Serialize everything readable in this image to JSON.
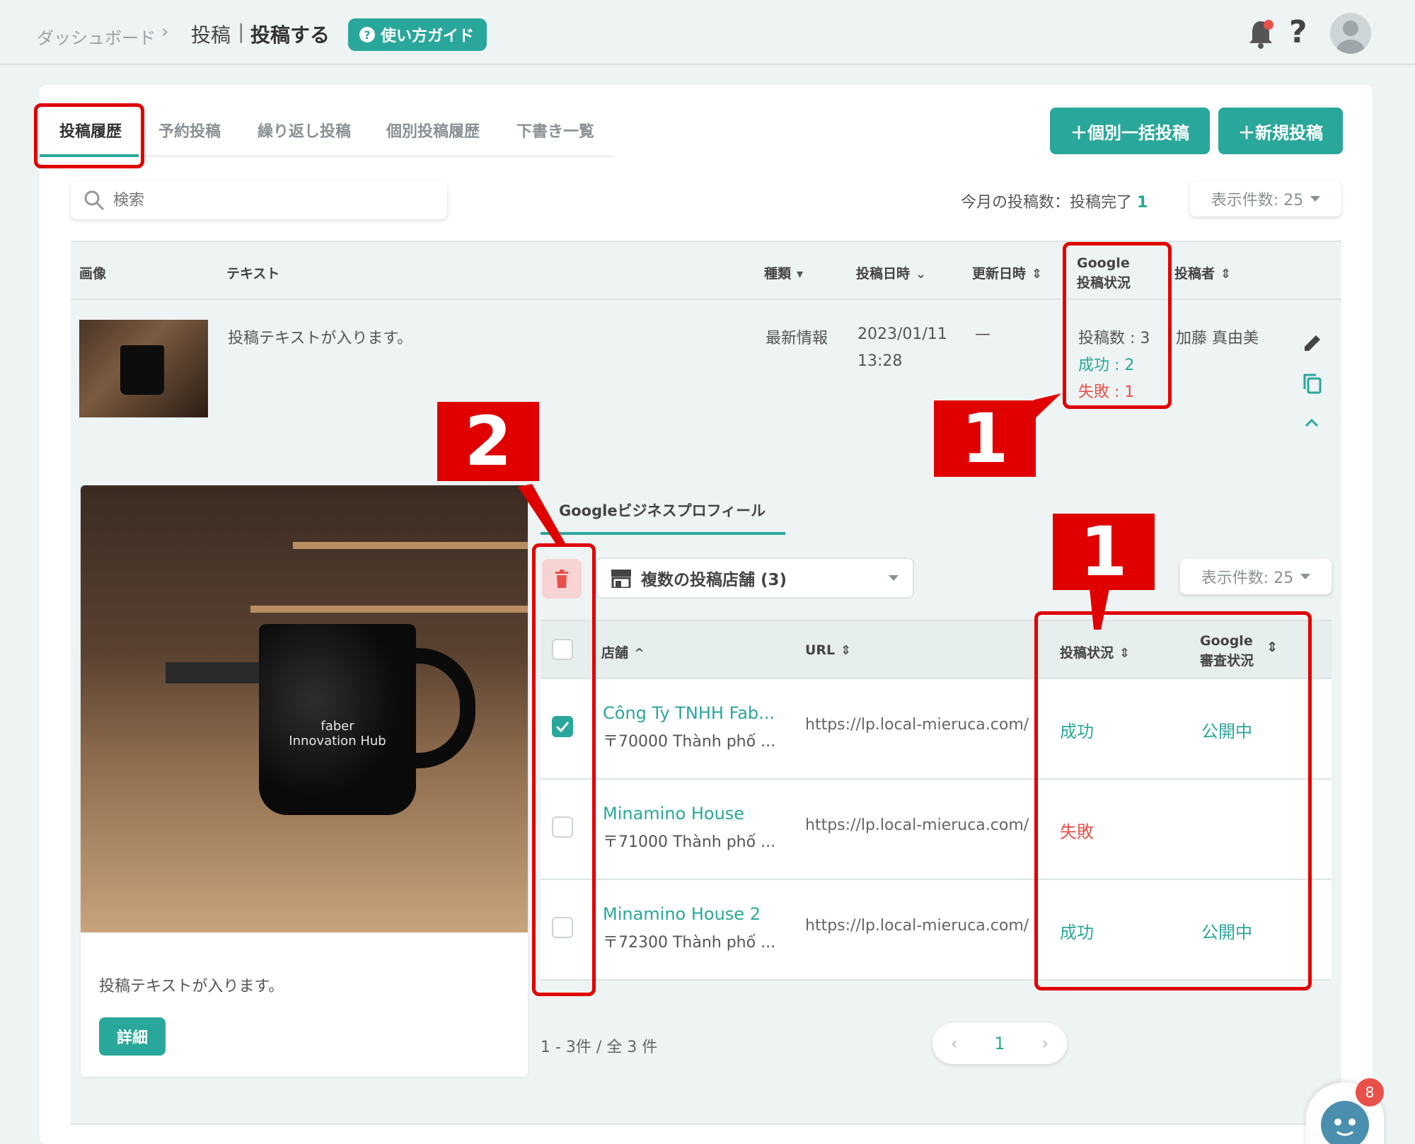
{
  "header": {
    "breadcrumb_home": "ダッシュボード",
    "breadcrumb_sep": "›",
    "breadcrumb_parent": "投稿",
    "breadcrumb_bar": "|",
    "breadcrumb_current": "投稿する",
    "guide_label": "使い方ガイド"
  },
  "tabs": [
    {
      "label": "投稿履歴",
      "active": true
    },
    {
      "label": "予約投稿"
    },
    {
      "label": "繰り返し投稿"
    },
    {
      "label": "個別投稿履歴"
    },
    {
      "label": "下書き一覧"
    }
  ],
  "actions": {
    "bulk_label": "＋個別一括投稿",
    "new_label": "＋新規投稿"
  },
  "search": {
    "placeholder": "検索"
  },
  "month_stat": {
    "prefix": "今月の投稿数：投稿完了",
    "count": "1"
  },
  "per_page": {
    "label": "表示件数: 25"
  },
  "table": {
    "headers": {
      "image": "画像",
      "text": "テキスト",
      "type": "種類",
      "posted": "投稿日時",
      "updated": "更新日時",
      "google_status_1": "Google",
      "google_status_2": "投稿状況",
      "author": "投稿者"
    },
    "row": {
      "text": "投稿テキストが入ります。",
      "type": "最新情報",
      "date": "2023/01/11",
      "time": "13:28",
      "updated": "—",
      "status_total": "投稿数 : 3",
      "status_success": "成功 : 2",
      "status_fail": "失敗 : 1",
      "author": "加藤 真由美"
    }
  },
  "preview": {
    "mug_text_1": "faber",
    "mug_text_2": "Innovation Hub",
    "text": "投稿テキストが入ります。",
    "detail_label": "詳細"
  },
  "sub": {
    "tab_label": "Googleビジネスプロフィール",
    "store_select": "複数の投稿店舗 (3)",
    "per_page": "表示件数: 25",
    "headers": {
      "store": "店舗",
      "url": "URL",
      "post_status": "投稿状況",
      "review_1": "Google",
      "review_2": "審査状況"
    },
    "rows": [
      {
        "name": "Công Ty TNHH Fab...",
        "addr": "〒70000 Thành phố ...",
        "url": "https://lp.local-mieruca.com/",
        "status": "成功",
        "review": "公開中",
        "checked": true
      },
      {
        "name": "Minamino House",
        "addr": "〒71000 Thành phố ...",
        "url": "https://lp.local-mieruca.com/",
        "status": "失敗",
        "review": "",
        "checked": false
      },
      {
        "name": "Minamino House 2",
        "addr": "〒72300 Thành phố ...",
        "url": "https://lp.local-mieruca.com/",
        "status": "成功",
        "review": "公開中",
        "checked": false
      }
    ],
    "pager_info": "1 - 3件 / 全 3 件",
    "page": "1"
  },
  "chat_badge": "8",
  "annotations": {
    "label_1": "1",
    "label_2": "2"
  },
  "colors": {
    "accent": "#2aa79b",
    "danger": "#e8504a",
    "annotation": "#e00000"
  }
}
